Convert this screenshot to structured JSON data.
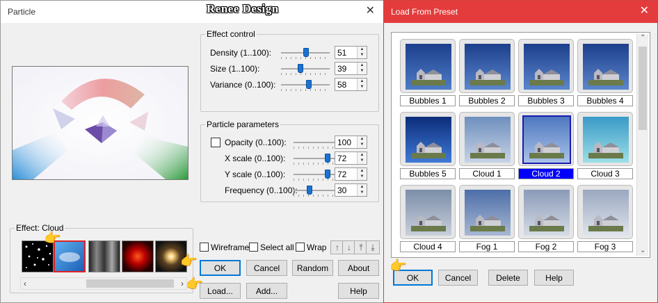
{
  "watermark": "Renee Design",
  "particle": {
    "title": "Particle",
    "effect_label": "Effect: Cloud",
    "effect_control": {
      "title": "Effect control",
      "rows": [
        {
          "label": "Density (1..100):",
          "value": "51",
          "level": 0.51
        },
        {
          "label": "Size (1..100):",
          "value": "39",
          "level": 0.39
        },
        {
          "label": "Variance (0..100):",
          "value": "58",
          "level": 0.58
        }
      ]
    },
    "particle_params": {
      "title": "Particle parameters",
      "rows": [
        {
          "label": "Opacity (0..100):",
          "value": "100",
          "level": 1.0
        },
        {
          "label": "X scale (0..100):",
          "value": "72",
          "level": 0.72
        },
        {
          "label": "Y scale (0..100):",
          "value": "72",
          "level": 0.72
        },
        {
          "label": "Frequency (0..100):",
          "value": "30",
          "level": 0.3
        }
      ]
    },
    "checks": {
      "wireframe": "Wireframe",
      "select_all": "Select all",
      "wrap": "Wrap"
    },
    "buttons": {
      "ok": "OK",
      "cancel": "Cancel",
      "random": "Random",
      "about": "About",
      "load": "Load...",
      "add": "Add...",
      "help": "Help"
    }
  },
  "preset": {
    "title": "Load From Preset",
    "items": [
      "Bubbles 1",
      "Bubbles 2",
      "Bubbles 3",
      "Bubbles 4",
      "Bubbles 5",
      "Cloud 1",
      "Cloud 2",
      "Cloud 3",
      "Cloud 4",
      "Fog 1",
      "Fog 2",
      "Fog 3"
    ],
    "selected": "Cloud 2",
    "buttons": {
      "ok": "OK",
      "cancel": "Cancel",
      "delete": "Delete",
      "help": "Help"
    }
  },
  "colors": {
    "accent": "#0078d7",
    "title_red": "#e43c3c",
    "selection": "#0000ff"
  }
}
